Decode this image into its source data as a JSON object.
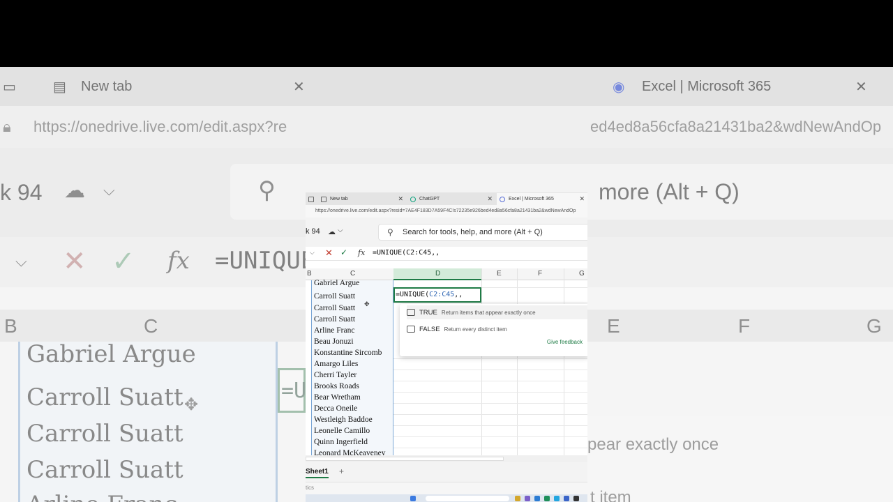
{
  "browser": {
    "tabs": [
      {
        "label": "New tab"
      },
      {
        "label": "ChatGPT"
      },
      {
        "label": "Excel | Microsoft 365"
      }
    ],
    "url": "https://onedrive.live.com/edit.aspx?resid=7AE4F183D7A59F4C!s72235e926bed4ed8a56cfa8a21431ba2&wdNewAndOp"
  },
  "app": {
    "doc_title": "k 94",
    "search_placeholder": "Search for tools, help, and more (Alt + Q)"
  },
  "formula_bar": {
    "formula": "=UNIQUE(C2:C45,,"
  },
  "grid": {
    "columns": [
      "B",
      "C",
      "D",
      "E",
      "F",
      "G"
    ],
    "names": [
      "Gabriel Argue",
      "Carroll Suatt",
      "Carroll Suatt",
      "Carroll Suatt",
      "Arline Franc",
      "Beau Jonuzi",
      "Konstantine Sircomb",
      "Amargo Liles",
      "Cherri Tayler",
      "Brooks Roads",
      "Bear Wretham",
      "Decca Oneile",
      "Westleigh Baddoe",
      "Leonelle Camillo",
      "Quinn Ingerfield",
      "Leonard McKeaveney"
    ],
    "active_cell": {
      "prefix": "=UNIQUE(",
      "ref": "C2:C45",
      "suffix": ",,"
    }
  },
  "autocomplete": {
    "options": [
      {
        "key": "TRUE",
        "desc": "Return items that appear exactly once"
      },
      {
        "key": "FALSE",
        "desc": "Return every distinct item"
      }
    ],
    "feedback": "Give feedback"
  },
  "sheet_tabs": {
    "active": "Sheet1",
    "add": "+"
  },
  "status": {
    "text": "tics"
  },
  "background": {
    "tab_left": "New tab",
    "tab_right": "Excel | Microsoft 365",
    "url_left": "https://onedrive.live.com/edit.aspx?re",
    "url_right": "ed4ed8a56cfa8a21431ba2&wdNewAndOp",
    "doc_title": "k 94",
    "search_tail": "more (Alt + Q)",
    "formula": "=UNIQUE",
    "cell_fragment": "=U",
    "names": [
      "Gabriel Argue",
      "Carroll Suatt",
      "Carroll Suatt",
      "Carroll Suatt",
      "Arline Franc"
    ],
    "popup_lines": [
      "pear exactly once",
      "t item"
    ]
  }
}
